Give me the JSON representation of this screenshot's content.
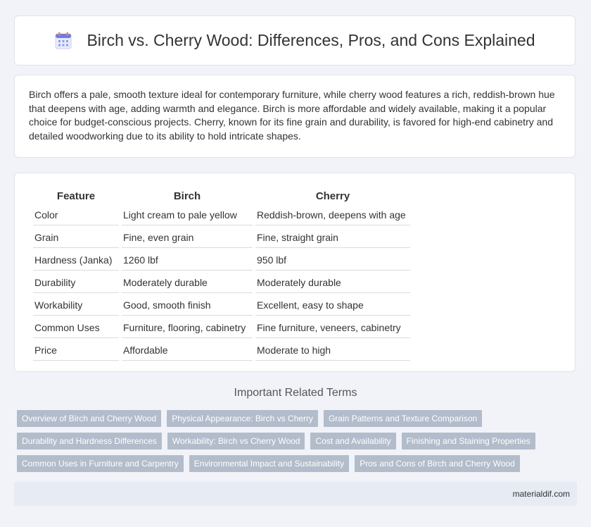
{
  "header": {
    "title": "Birch vs. Cherry Wood: Differences, Pros, and Cons Explained",
    "icon": "calendar-icon"
  },
  "intro": {
    "text": "Birch offers a pale, smooth texture ideal for contemporary furniture, while cherry wood features a rich, reddish-brown hue that deepens with age, adding warmth and elegance. Birch is more affordable and widely available, making it a popular choice for budget-conscious projects. Cherry, known for its fine grain and durability, is favored for high-end cabinetry and detailed woodworking due to its ability to hold intricate shapes."
  },
  "table": {
    "headers": [
      "Feature",
      "Birch",
      "Cherry"
    ],
    "rows": [
      [
        "Color",
        "Light cream to pale yellow",
        "Reddish-brown, deepens with age"
      ],
      [
        "Grain",
        "Fine, even grain",
        "Fine, straight grain"
      ],
      [
        "Hardness (Janka)",
        "1260 lbf",
        "950 lbf"
      ],
      [
        "Durability",
        "Moderately durable",
        "Moderately durable"
      ],
      [
        "Workability",
        "Good, smooth finish",
        "Excellent, easy to shape"
      ],
      [
        "Common Uses",
        "Furniture, flooring, cabinetry",
        "Fine furniture, veneers, cabinetry"
      ],
      [
        "Price",
        "Affordable",
        "Moderate to high"
      ]
    ]
  },
  "related": {
    "title": "Important Related Terms",
    "tags": [
      [
        "Overview of Birch and Cherry Wood",
        "Physical Appearance: Birch vs Cherry",
        "Grain Patterns and Texture Comparison"
      ],
      [
        "Durability and Hardness Differences",
        "Workability: Birch vs Cherry Wood",
        "Cost and Availability",
        "Finishing and Staining Properties"
      ],
      [
        "Common Uses in Furniture and Carpentry",
        "Environmental Impact and Sustainability",
        "Pros and Cons of Birch and Cherry Wood"
      ]
    ]
  },
  "footer": {
    "text": "materialdif.com"
  }
}
